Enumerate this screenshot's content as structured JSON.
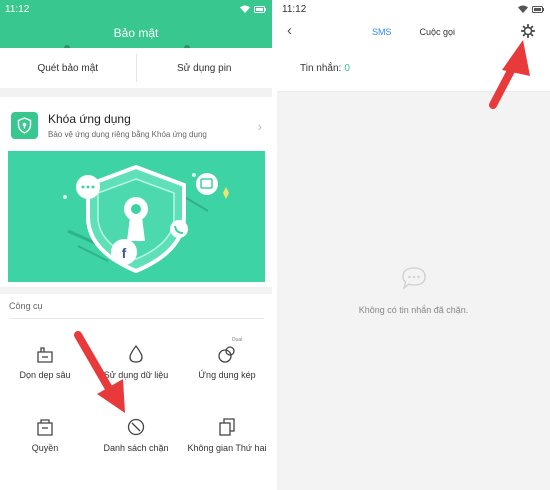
{
  "left": {
    "status_time": "11:12",
    "header_title": "Bảo mật",
    "quick": [
      "Quét bảo mật",
      "Sử dụng pin"
    ],
    "app_lock": {
      "title": "Khóa ứng dụng",
      "subtitle": "Bảo vệ ứng dụng riêng bằng Khóa ứng dụng"
    },
    "tools_title": "Công cụ",
    "dual_tag": "Dual",
    "tools": [
      {
        "label": "Dọn dẹp sâu",
        "icon": "broom-icon"
      },
      {
        "label": "Sử dụng dữ liệu",
        "icon": "water-drop-icon"
      },
      {
        "label": "Ứng dụng kép",
        "icon": "dual-apps-icon"
      },
      {
        "label": "Quyền",
        "icon": "permissions-icon"
      },
      {
        "label": "Danh sách chặn",
        "icon": "block-icon"
      },
      {
        "label": "Không gian Thứ hai",
        "icon": "second-space-icon"
      }
    ]
  },
  "right": {
    "status_time": "11:12",
    "tabs": [
      "SMS",
      "Cuộc gọi"
    ],
    "active_tab": "SMS",
    "msg_label": "Tin nhắn:",
    "msg_count": "0",
    "empty_text": "Không có tin nhắn đã chặn."
  },
  "colors": {
    "accent_green": "#38c78e",
    "banner": "#3dd3a4",
    "tab_active": "#2d8cf0",
    "arrow_red": "#e8393b"
  }
}
